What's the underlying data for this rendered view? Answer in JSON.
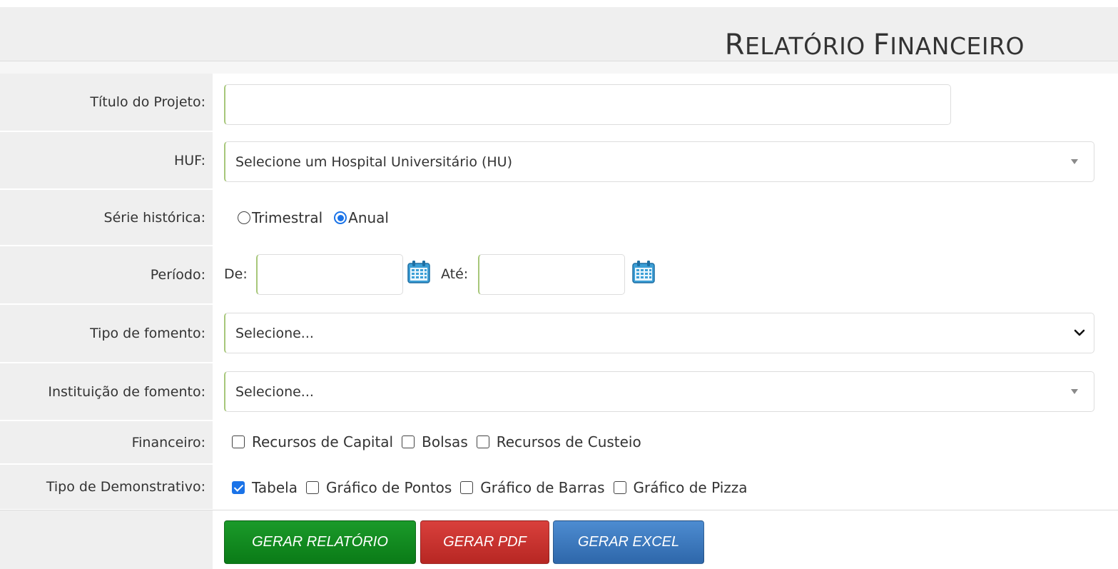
{
  "header": {
    "title_first": "R",
    "title_rest1": "ELATÓRIO ",
    "title_cap2": "F",
    "title_rest2": "INANCEIRO"
  },
  "form": {
    "titulo": {
      "label": "Título do Projeto:",
      "value": ""
    },
    "huf": {
      "label": "HUF:",
      "value": "Selecione um Hospital Universitário (HU)"
    },
    "serie": {
      "label": "Série histórica:",
      "options": [
        {
          "label": "Trimestral",
          "checked": false
        },
        {
          "label": "Anual",
          "checked": true
        }
      ]
    },
    "periodo": {
      "label": "Período:",
      "from_label": "De:",
      "to_label": "Até:",
      "from_value": "",
      "to_value": ""
    },
    "tipo_fomento": {
      "label": "Tipo de fomento:",
      "value": "Selecione..."
    },
    "instituicao": {
      "label": "Instituição de fomento:",
      "value": "Selecione..."
    },
    "financeiro": {
      "label": "Financeiro:",
      "options": [
        {
          "label": "Recursos de Capital",
          "checked": false
        },
        {
          "label": "Bolsas",
          "checked": false
        },
        {
          "label": "Recursos de Custeio",
          "checked": false
        }
      ]
    },
    "demonstrativo": {
      "label": "Tipo de Demonstrativo:",
      "options": [
        {
          "label": "Tabela",
          "checked": true
        },
        {
          "label": "Gráfico de Pontos",
          "checked": false
        },
        {
          "label": "Gráfico de Barras",
          "checked": false
        },
        {
          "label": "Gráfico de Pizza",
          "checked": false
        }
      ]
    }
  },
  "buttons": {
    "gerar_relatorio": "GERAR RELATÓRIO",
    "gerar_pdf": "GERAR PDF",
    "gerar_excel": "GERAR EXCEL"
  },
  "colors": {
    "green": "#0a7b17",
    "red": "#c9302c",
    "blue": "#3a74b8",
    "accent_border": "#a7c77a",
    "checked": "#1a73e8"
  },
  "icons": {
    "calendar": "calendar-icon",
    "dropdown": "caret-down-icon",
    "chevron": "chevron-down-icon"
  }
}
